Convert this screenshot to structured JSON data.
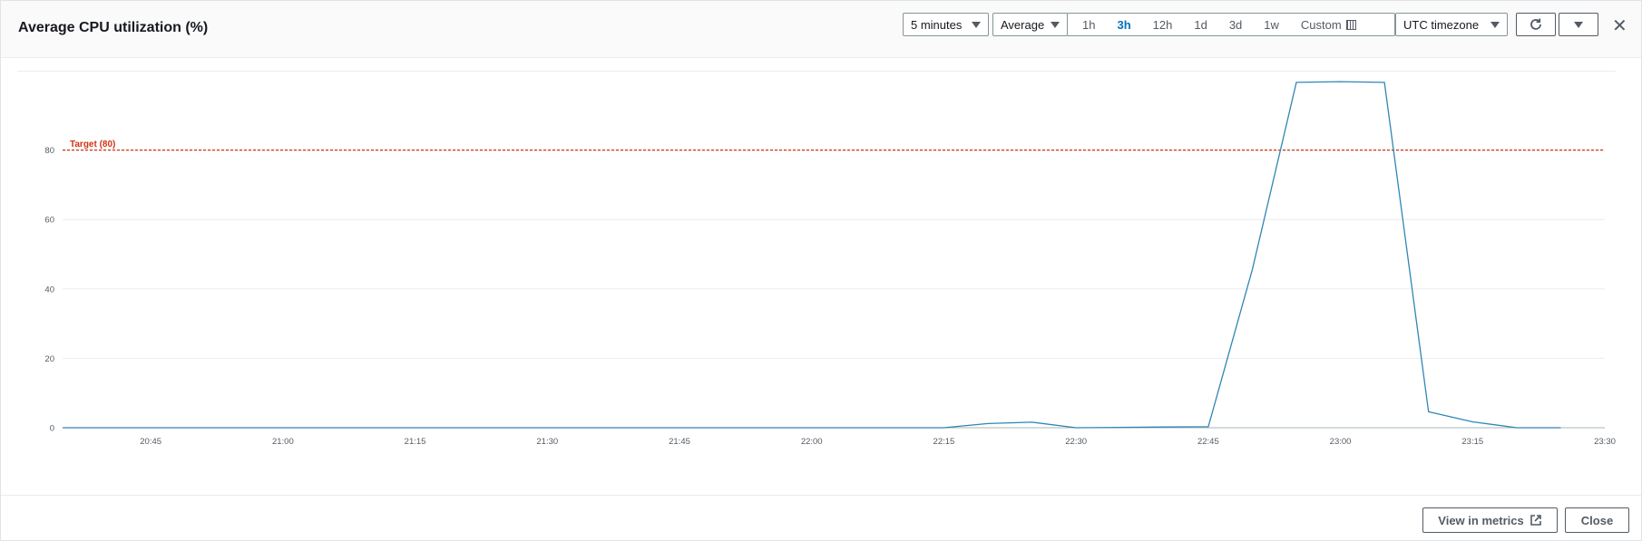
{
  "header": {
    "title": "Average CPU utilization (%)",
    "period": "5 minutes",
    "statistic": "Average",
    "ranges": [
      "1h",
      "3h",
      "12h",
      "1d",
      "3d",
      "1w"
    ],
    "active_range": "3h",
    "custom_label": "Custom",
    "timezone": "UTC timezone"
  },
  "footer": {
    "view_metrics_label": "View in metrics",
    "close_label": "Close"
  },
  "colors": {
    "series": "#2f86b5",
    "threshold": "#d13212",
    "active_range": "#0073bb"
  },
  "chart_data": {
    "type": "line",
    "title": "Average CPU utilization (%)",
    "xlabel": "",
    "ylabel": "",
    "ylim": [
      0,
      100
    ],
    "yticks": [
      0,
      20,
      40,
      60,
      80
    ],
    "xlim": [
      "20:35",
      "23:30"
    ],
    "xticks": [
      "20:45",
      "21:00",
      "21:15",
      "21:30",
      "21:45",
      "22:00",
      "22:15",
      "22:30",
      "22:45",
      "23:00",
      "23:15",
      "23:30"
    ],
    "grid": true,
    "series": [
      {
        "x": [
          "20:35",
          "20:40",
          "20:45",
          "20:50",
          "20:55",
          "21:00",
          "21:05",
          "21:10",
          "21:15",
          "21:20",
          "21:25",
          "21:30",
          "21:35",
          "21:40",
          "21:45",
          "21:50",
          "21:55",
          "22:00",
          "22:05",
          "22:10",
          "22:15",
          "22:20",
          "22:25",
          "22:30",
          "22:35",
          "22:40",
          "22:45",
          "22:50",
          "22:55",
          "23:00",
          "23:05",
          "23:10",
          "23:15",
          "23:20",
          "23:25"
        ],
        "values": [
          0,
          0,
          0,
          0,
          0,
          0,
          0,
          0,
          0,
          0,
          0,
          0,
          0,
          0,
          0,
          0,
          0,
          0,
          0,
          0,
          0,
          1.2,
          1.6,
          0,
          0.1,
          0.2,
          0.3,
          45.5,
          99.5,
          99.7,
          99.5,
          4.6,
          1.7,
          0,
          0
        ]
      }
    ],
    "annotations": [
      {
        "type": "hline",
        "y": 80,
        "label": "Target (80)"
      }
    ]
  }
}
